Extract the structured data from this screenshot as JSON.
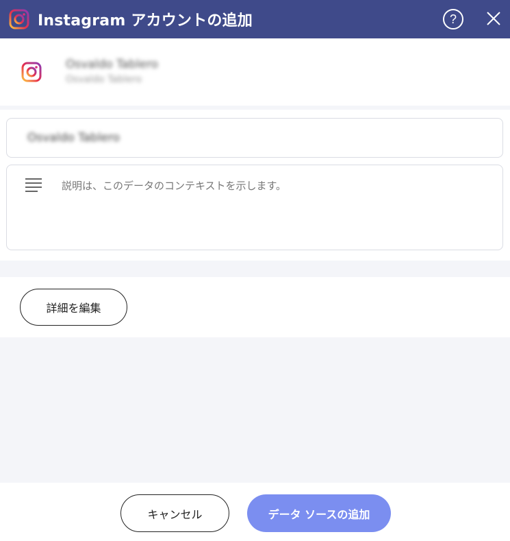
{
  "dialog": {
    "title": "Instagram アカウントの追加",
    "help_symbol": "?"
  },
  "account": {
    "name": "Osvaldo Tablero",
    "subtitle": "Osvaldo Tablero"
  },
  "form": {
    "name_value": "Osvaldo Tablero",
    "description_placeholder": "説明は、このデータのコンテキストを示します。"
  },
  "edit": {
    "label": "詳細を編集"
  },
  "footer": {
    "cancel_label": "キャンセル",
    "add_label": "データ ソースの追加"
  },
  "colors": {
    "titlebar": "#3f4a8a",
    "primary_button": "#7b8ef0",
    "background": "#f4f5f9"
  },
  "icons": [
    "instagram-icon",
    "help-icon",
    "close-icon",
    "description-lines-icon"
  ]
}
